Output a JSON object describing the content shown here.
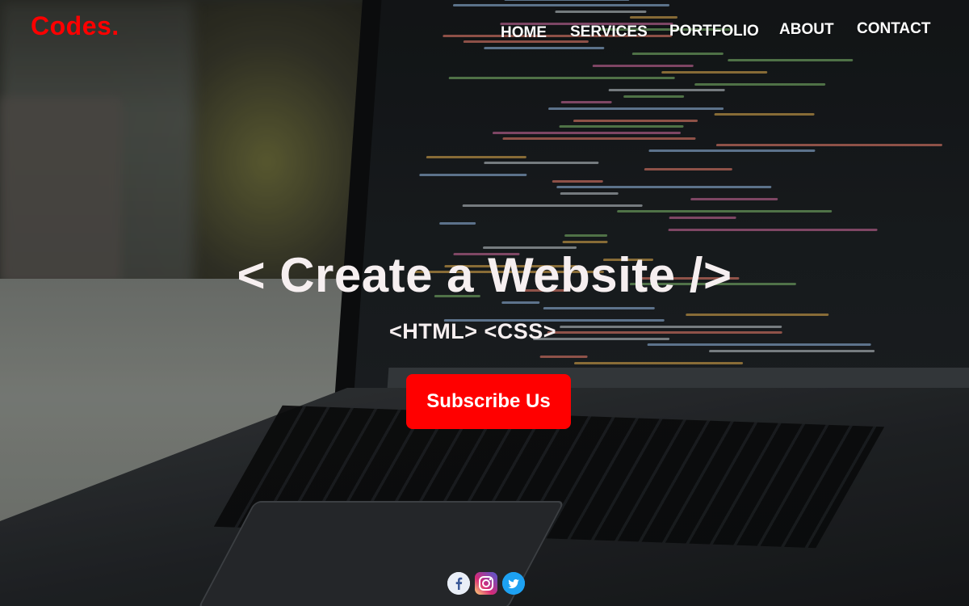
{
  "colors": {
    "brand": "#ff0000",
    "button": "#ff0000",
    "text": "#ffffff"
  },
  "header": {
    "logo": "Codes.",
    "nav": [
      "HOME",
      "SERVICES",
      "PORTFOLIO",
      "ABOUT",
      "CONTACT"
    ]
  },
  "hero": {
    "title": "< Create a Website />",
    "subtitle": "<HTML> <CSS>",
    "button_label": "Subscribe Us"
  },
  "social": {
    "icons": [
      "facebook-icon",
      "instagram-icon",
      "twitter-icon"
    ]
  }
}
